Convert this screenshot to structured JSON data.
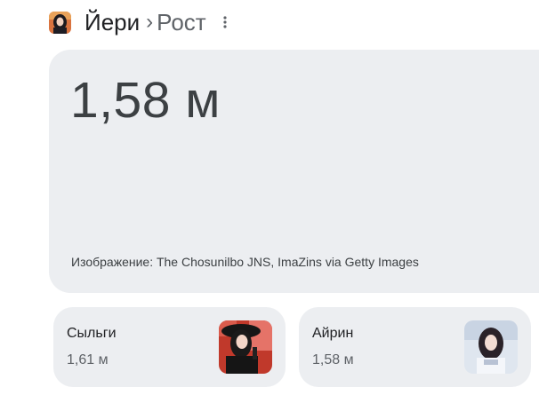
{
  "header": {
    "entity_name": "Йери",
    "separator": "›",
    "attribute": "Рост",
    "more_icon": "more-vert-icon"
  },
  "answer": {
    "value": "1,58 м",
    "image_credit": "Изображение: The Chosunilbo JNS, ImaZins via Getty Images"
  },
  "related": [
    {
      "name": "Сыльги",
      "value": "1,61 м"
    },
    {
      "name": "Айрин",
      "value": "1,58 м"
    }
  ],
  "colors": {
    "card_bg": "#eceef1",
    "text_primary": "#202124",
    "text_secondary": "#5f6368"
  }
}
